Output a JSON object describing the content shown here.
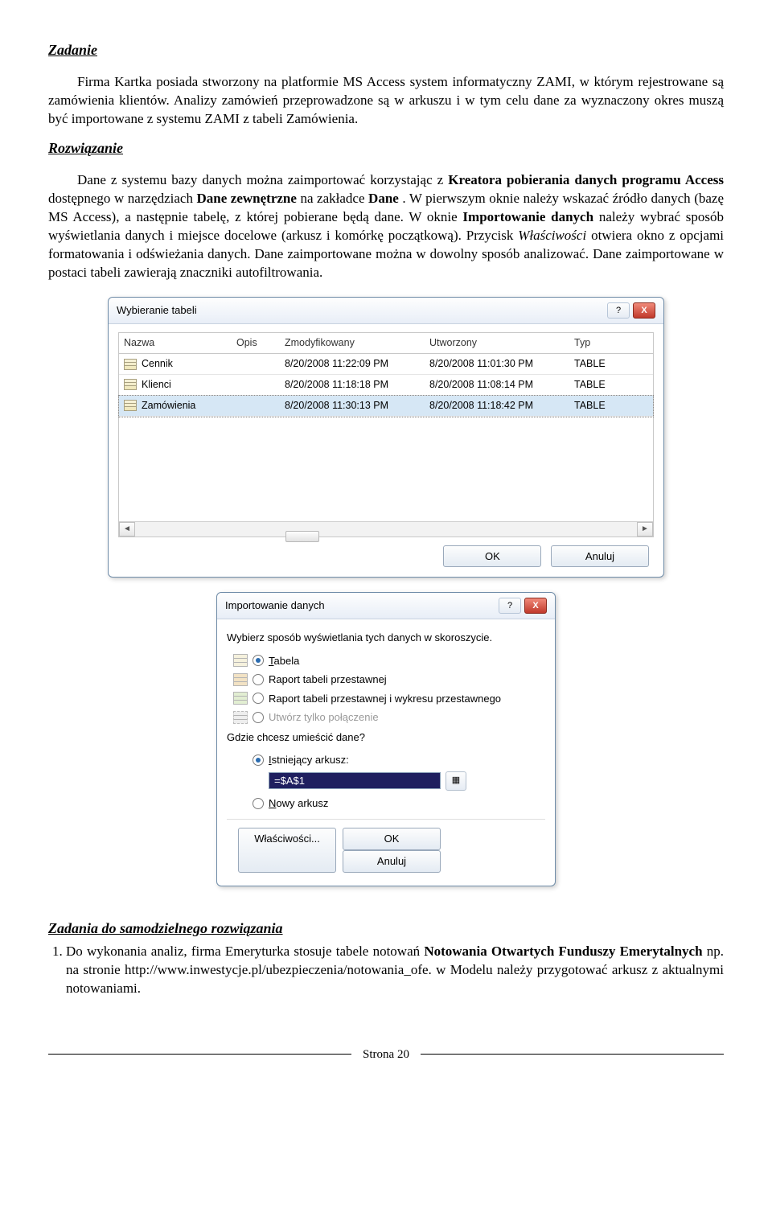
{
  "sections": {
    "zadanie_heading": "Zadanie",
    "zadanie_p1_a": "Firma Kartka posiada stworzony na platformie MS Access system informatyczny ZAMI, w którym rejestrowane są zamówienia klientów. Analizy zamówień przeprowadzone są w arkuszu i w tym celu dane za wyznaczony okres muszą być importowane z systemu ZAMI z tabeli Zamówienia.",
    "rozw_heading": "Rozwiązanie",
    "rozw_p_pre1": "Dane z systemu bazy danych można zaimportować  korzystając z ",
    "rozw_bold1": "Kreatora pobierania danych programu Access",
    "rozw_mid1": " dostępnego w narzędziach ",
    "rozw_bold2": "Dane zewnętrzne",
    "rozw_mid2": " na zakładce ",
    "rozw_bold3": "Dane",
    "rozw_after1": ". W pierwszym oknie należy wskazać źródło danych (bazę MS Access), a następnie tabelę, z której pobierane będą dane. W oknie ",
    "rozw_bold4": "Importowanie danych",
    "rozw_after2": " należy wybrać sposób wyświetlania danych i miejsce docelowe (arkusz i komórkę początkową). Przycisk ",
    "rozw_ital1": "Właściwości",
    "rozw_after3": " otwiera okno z opcjami formatowania i odświeżania danych. Dane zaimportowane można w dowolny sposób analizować. Dane zaimportowane w postaci tabeli zawierają znaczniki autofiltrowania.",
    "samodz_heading": "Zadania do samodzielnego rozwiązania",
    "samodz_item1_a": "Do wykonania analiz, firma Emeryturka stosuje tabele notowań ",
    "samodz_item1_b": "Notowania Otwartych Funduszy Emerytalnych",
    "samodz_item1_c": " np. na  stronie http://www.inwestycje.pl/ubezpieczenia/notowania_ofe. w Modelu należy przygotować arkusz z aktualnymi notowaniami."
  },
  "dialog1": {
    "title": "Wybieranie tabeli",
    "help": "?",
    "close": "X",
    "cols": {
      "c1": "Nazwa",
      "c2": "Opis",
      "c3": "Zmodyfikowany",
      "c4": "Utworzony",
      "c5": "Typ"
    },
    "rows": [
      {
        "name": "Cennik",
        "desc": "",
        "mod": "8/20/2008 11:22:09 PM",
        "cre": "8/20/2008 11:01:30 PM",
        "type": "TABLE",
        "selected": false
      },
      {
        "name": "Klienci",
        "desc": "",
        "mod": "8/20/2008 11:18:18 PM",
        "cre": "8/20/2008 11:08:14 PM",
        "type": "TABLE",
        "selected": false
      },
      {
        "name": "Zamówienia",
        "desc": "",
        "mod": "8/20/2008 11:30:13 PM",
        "cre": "8/20/2008 11:18:42 PM",
        "type": "TABLE",
        "selected": true
      }
    ],
    "ok": "OK",
    "cancel": "Anuluj"
  },
  "dialog2": {
    "title": "Importowanie danych",
    "help": "?",
    "close": "X",
    "prompt1": "Wybierz sposób wyświetlania tych danych w skoroszycie.",
    "optTable_pre": "T",
    "optTable_post": "abela",
    "optPivot": "Raport tabeli przestawnej",
    "optPivotChart": "Raport tabeli przestawnej i wykresu przestawnego",
    "optConn": "Utwórz tylko połączenie",
    "prompt2": "Gdzie chcesz umieścić dane?",
    "optExist_pre": "I",
    "optExist_post": "stniejący arkusz:",
    "refValue": "=$A$1",
    "optNew_pre": "N",
    "optNew_post": "owy arkusz",
    "btnProps": "Właściwości...",
    "ok": "OK",
    "cancel": "Anuluj"
  },
  "footer": {
    "page": "Strona 20"
  }
}
